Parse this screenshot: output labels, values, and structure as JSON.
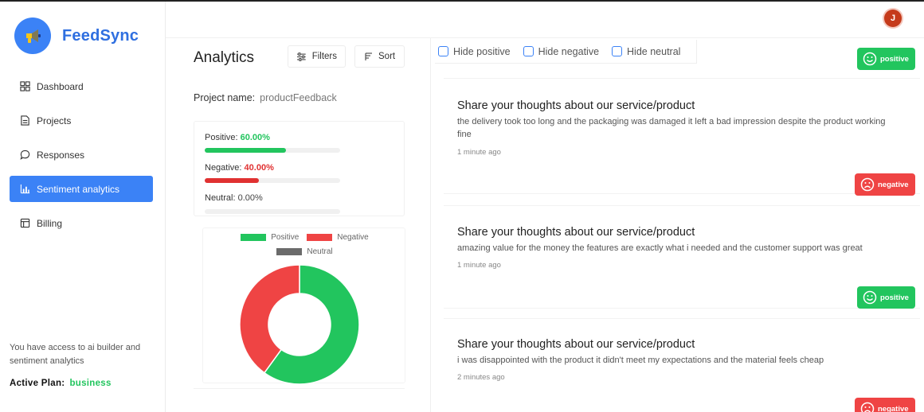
{
  "brand": {
    "name": "FeedSync"
  },
  "nav": {
    "items": [
      {
        "label": "Dashboard",
        "icon": "dashboard-icon"
      },
      {
        "label": "Projects",
        "icon": "projects-icon"
      },
      {
        "label": "Responses",
        "icon": "chat-bubble-icon"
      },
      {
        "label": "Sentiment analytics",
        "icon": "bar-chart-icon",
        "active": true
      },
      {
        "label": "Billing",
        "icon": "billing-icon"
      }
    ]
  },
  "plan": {
    "note": "You have access to ai builder and sentiment analytics",
    "label": "Active Plan:",
    "value": "business"
  },
  "user": {
    "avatar_initial": "J",
    "avatar_color": "#c53a1b"
  },
  "analytics": {
    "title": "Analytics",
    "filters_label": "Filters",
    "sort_label": "Sort",
    "project_label": "Project name:",
    "project_value": "productFeedback"
  },
  "stats": {
    "positive": {
      "label": "Positive:",
      "value": "60.00%",
      "fraction": 0.6,
      "color": "#22c55e"
    },
    "negative": {
      "label": "Negative:",
      "value": "40.00%",
      "fraction": 0.4,
      "color": "#e03131"
    },
    "neutral": {
      "label": "Neutral:",
      "value": "0.00%",
      "fraction": 0.0,
      "color": "#6b6b6b"
    }
  },
  "chart_data": {
    "type": "pie",
    "donut": true,
    "title": "",
    "categories": [
      "Positive",
      "Negative",
      "Neutral"
    ],
    "values": [
      60,
      40,
      0
    ],
    "colors": [
      "#22c55e",
      "#ef4444",
      "#6b6b6b"
    ],
    "legend": "top"
  },
  "filters": {
    "hide_positive": "Hide positive",
    "hide_negative": "Hide negative",
    "hide_neutral": "Hide neutral"
  },
  "feed": {
    "top_badge": {
      "sentiment": "positive",
      "label": "positive"
    },
    "cards": [
      {
        "question": "Share your thoughts about our service/product",
        "answer": "the delivery took too long and the packaging was damaged it left a bad impression despite the product working fine",
        "time": "1 minute ago",
        "sentiment": "negative",
        "badge_label": "negative"
      },
      {
        "question": "Share your thoughts about our service/product",
        "answer": "amazing value for the money the features are exactly what i needed and the customer support was great",
        "time": "1 minute ago",
        "sentiment": "positive",
        "badge_label": "positive"
      },
      {
        "question": "Share your thoughts about our service/product",
        "answer": "i was disappointed with the product it didn't meet my expectations and the material feels cheap",
        "time": "2 minutes ago",
        "sentiment": "negative",
        "badge_label": "negative"
      }
    ]
  }
}
